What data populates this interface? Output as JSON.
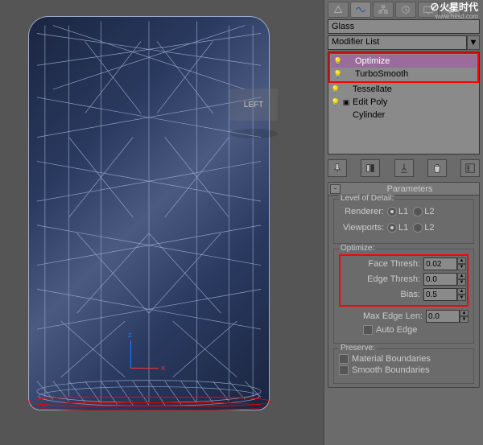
{
  "watermark": {
    "logo": "⊘火星时代",
    "url": "www.hxsd.com"
  },
  "viewport": {
    "left_label": "LEFT",
    "axis_z": "z",
    "axis_x": "x"
  },
  "object_name": "Glass",
  "modifier_list_label": "Modifier List",
  "modifiers": {
    "items": [
      {
        "label": "Optimize"
      },
      {
        "label": "TurboSmooth"
      },
      {
        "label": "Tessellate"
      },
      {
        "label": "Edit Poly"
      },
      {
        "label": "Cylinder"
      }
    ]
  },
  "rollout": {
    "title": "Parameters",
    "minus": "-",
    "level_of_detail": {
      "legend": "Level of Detail:",
      "renderer_label": "Renderer:",
      "viewports_label": "Viewports:",
      "l1": "L1",
      "l2": "L2"
    },
    "optimize": {
      "legend": "Optimize:",
      "face_thresh_label": "Face Thresh:",
      "face_thresh_value": "0.02",
      "edge_thresh_label": "Edge Thresh:",
      "edge_thresh_value": "0.0",
      "bias_label": "Bias:",
      "bias_value": "0.5",
      "max_edge_len_label": "Max Edge Len:",
      "max_edge_len_value": "0.0",
      "auto_edge_label": "Auto Edge"
    },
    "preserve": {
      "legend": "Preserve:",
      "material_boundaries": "Material Boundaries",
      "smooth_boundaries": "Smooth Boundaries"
    }
  }
}
